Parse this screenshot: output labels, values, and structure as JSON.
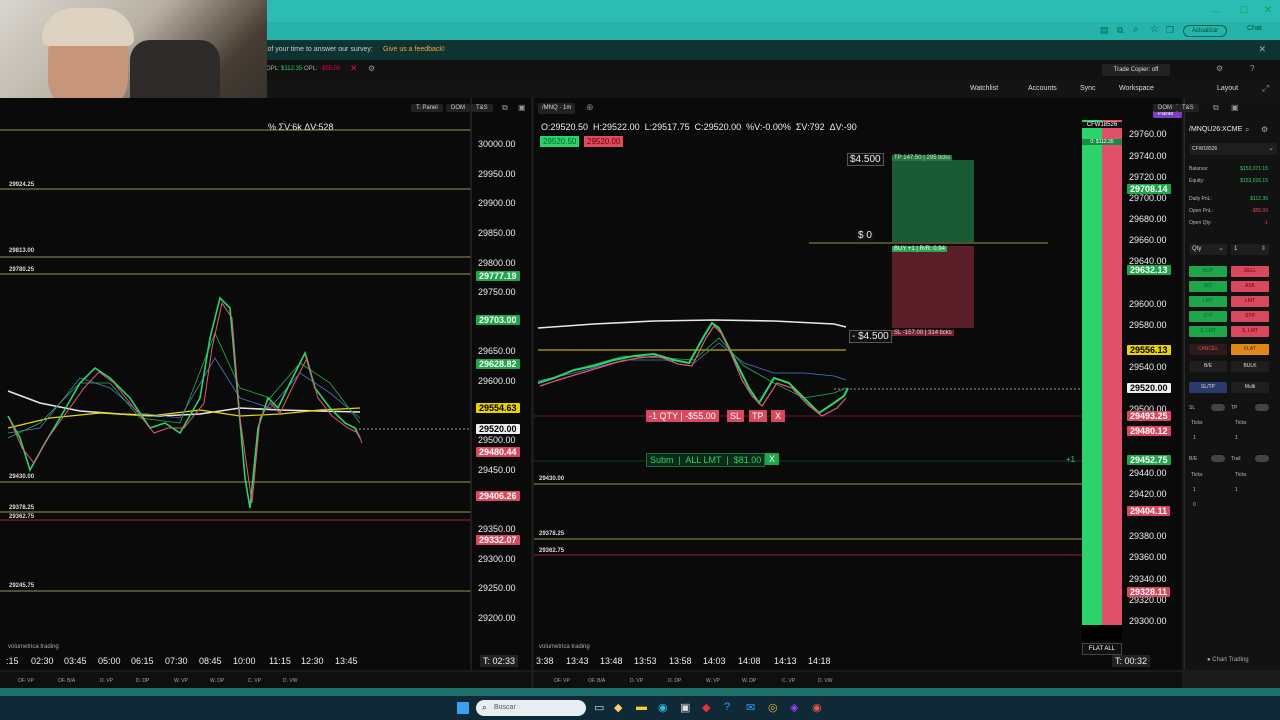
{
  "browser": {
    "actualizar": "Actualizar",
    "chat": "Chat"
  },
  "notice": {
    "text": "s of your time to answer our survey:",
    "link": "Give us a feedback!"
  },
  "toolbar": {
    "opl_label": "OPL:",
    "opl_value": "$112.35",
    "opl2_label": "OPL:",
    "opl2_value": "-$55.00",
    "trade_copier": "Trade Copier: off"
  },
  "topnav": {
    "watchlist": "Watchlist",
    "accounts": "Accounts",
    "sync": "Sync",
    "workspace": "Workspace",
    "layout": "Layout"
  },
  "left_chart": {
    "tabs": [
      "T. Panel",
      "DOM",
      "T&S"
    ],
    "stats": "% ΣV:6k ΔV:528",
    "y_ticks": [
      "30000.00",
      "29950.00",
      "29900.00",
      "29850.00",
      "29800.00",
      "29750.00",
      "29650.00",
      "29600.00",
      "29500.00",
      "29450.00",
      "29350.00",
      "29300.00",
      "29250.00",
      "29200.00"
    ],
    "price_tags": {
      "t1": "29777.19",
      "t2": "29703.00",
      "t3": "29628.82",
      "t4": "29554.63",
      "t5": "29520.00",
      "t6": "29480.44",
      "t7": "29406.26",
      "t8": "29332.07"
    },
    "hlines": [
      "29924.25",
      "29813.00",
      "29780.25",
      "29430.00",
      "29378.25",
      "29362.75",
      "29245.75"
    ],
    "x_ticks": [
      ":15",
      "02:30",
      "03:45",
      "05:00",
      "06:15",
      "07:30",
      "08:45",
      "10:00",
      "11:15",
      "12:30",
      "13:45"
    ],
    "timer": "T: 02:33",
    "logo": "volumetrica trading",
    "bottom_tabs": [
      "OF. VP",
      "OF. B/A",
      "D. VP",
      "D. DP",
      "W. VP",
      "W. DP",
      "C. VP",
      "D. VW"
    ]
  },
  "right_chart": {
    "symbol": "/MNQ",
    "tf": "1m",
    "tabs": [
      "T. Panel",
      "DOM",
      "T&S"
    ],
    "ohlc": "O:29520.50  H:29522.00  L:29517.75  C:29520.00  %V:-0.00%  ΣV:792  ΔV:-90",
    "bid_btn": "29520.50",
    "ask_btn": "29520.00",
    "tp_dollar": "$4.500",
    "tp_label": "TP 147.50 | 295 ticks",
    "zero": "$ 0",
    "entry_label": "BUY +1 | R/R: 0.94",
    "sl_dollar": "- $4.500",
    "sl_label": "SL -157.00 | 314 ticks",
    "pos_label": "-1 QTY | -$55.00",
    "pos_sl": "SL",
    "pos_tp": "TP",
    "pos_x": "X",
    "order_label": "Subm  |  ALL LMT  |  $81.00",
    "order_x": "X",
    "plus1": "+1",
    "y_ticks": [
      "29760.00",
      "29740.00",
      "29720.00",
      "29700.00",
      "29680.00",
      "29660.00",
      "29640.00",
      "29600.00",
      "29580.00",
      "29540.00",
      "29500.00",
      "29440.00",
      "29420.00",
      "29380.00",
      "29360.00",
      "29340.00",
      "29320.00",
      "29300.00"
    ],
    "price_tags": {
      "t1": "29708.14",
      "t2": "29632.13",
      "t3": "29556.13",
      "t4": "29520.00",
      "t5": "29493.25",
      "t6": "29480.12",
      "t7": "29452.75",
      "t8": "29404.11",
      "t9": "29328.11"
    },
    "hlines": [
      "29430.00",
      "29378.25",
      "29362.75"
    ],
    "x_ticks": [
      "3:38",
      "13:43",
      "13:48",
      "13:53",
      "13:58",
      "14:03",
      "14:08",
      "14:13",
      "14:18"
    ],
    "timer": "T: 00:32",
    "account_tag": "CFW18526",
    "account_pnl": "0: $112.35",
    "flat_all": "FLAT ALL",
    "logo": "volumetrica trading",
    "bottom_tabs": [
      "OF. VP",
      "OF. B/A",
      "D. VP",
      "D. DP",
      "W. VP",
      "W. DP",
      "C. VP",
      "D. VW"
    ]
  },
  "side_panel": {
    "symbol": "/MNQU26:XCME",
    "account": "CFW18526",
    "balance_label": "Balance:",
    "balance": "$153,071.15",
    "equity_label": "Equity:",
    "equity": "$153,016.15",
    "dpnl_label": "Daily PnL:",
    "dpnl": "$112.35",
    "opnl_label": "Open PnL:",
    "opnl": "-$55.00",
    "oqty_label": "Open Qty:",
    "oqty": "-1",
    "qty_label": "Qty",
    "qty_val": "1",
    "buttons": {
      "buy": "BUY",
      "sell": "SELL",
      "bid": "BID",
      "ask": "ASK",
      "lmt1": "LMT",
      "lmt2": "LMT",
      "stp1": "STP",
      "stp2": "STP",
      "slmt1": "S. LMT",
      "slmt2": "S. LMT",
      "cancel": "CANCEL",
      "flat": "FLAT",
      "be": "B/E",
      "bulk": "BULK",
      "sltp": "SL/TP",
      "multi": "Multi"
    },
    "sl": "SL",
    "tp": "TP",
    "ticks": "Ticks",
    "be2": "B/E",
    "trail": "Trail",
    "one": "1",
    "zero": "0",
    "chart_trading": "Chart Trading"
  },
  "taskbar": {
    "search": "Buscar"
  }
}
